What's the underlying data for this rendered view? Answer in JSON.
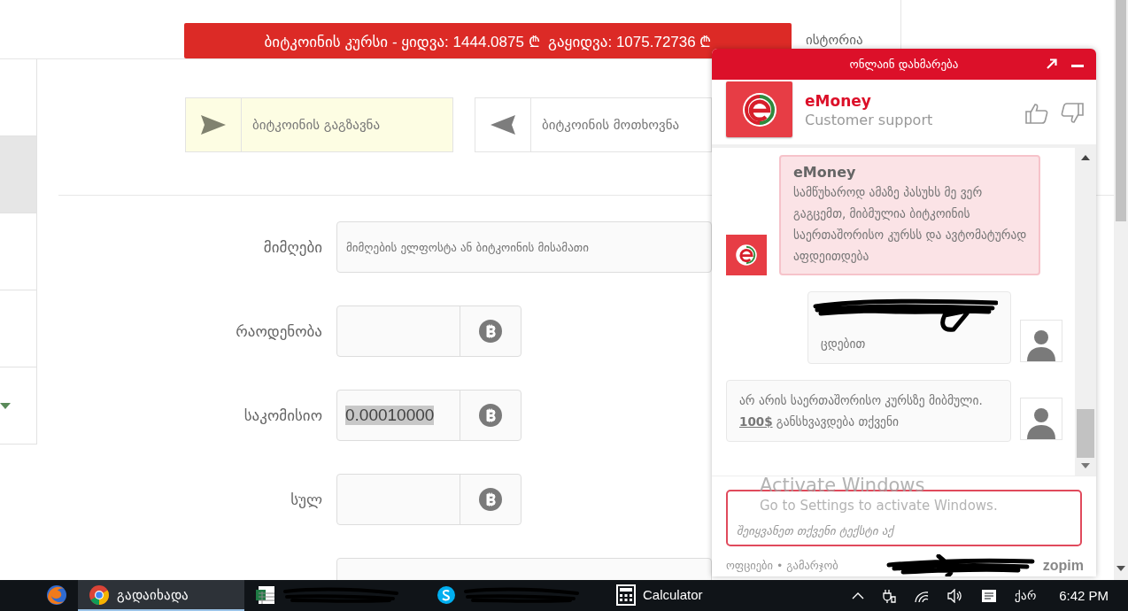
{
  "rate_banner": {
    "text": "ბიტკოინის კურსი - ყიდვა: 1444.0875 ₾  გაყიდვა: 1075.72736 ₾"
  },
  "history_link": "ისტორია",
  "sidebar_rows": [
    {
      "selected": false,
      "kind": "plain"
    },
    {
      "selected": true,
      "kind": "plain"
    },
    {
      "selected": false,
      "kind": "plain"
    },
    {
      "selected": false,
      "kind": "plain"
    },
    {
      "selected": false,
      "kind": "dropdown"
    }
  ],
  "action_buttons": [
    {
      "kind": "send",
      "label": "ბიტკოინის გაგზავნა",
      "selected": true
    },
    {
      "kind": "request",
      "label": "ბიტკოინის მოთხოვნა",
      "selected": false
    }
  ],
  "form": {
    "fields": [
      {
        "kind": "text",
        "label": "მიმღები",
        "placeholder": "მიმღების ელფოსტა ან ბიტკოინის მისამათი"
      },
      {
        "kind": "btc",
        "label": "რაოდენობა"
      },
      {
        "kind": "btc",
        "label": "საკომისიო",
        "value": "0.00010000",
        "value_selected": true
      },
      {
        "kind": "btc",
        "label": "სულ"
      },
      {
        "kind": "text"
      }
    ]
  },
  "chat": {
    "title": "ონლაინ დახმარება",
    "agent": {
      "name": "eMoney",
      "role": "Customer support"
    },
    "messages": [
      {
        "kind": "agent",
        "name": "eMoney",
        "text": "სამწუხაროდ ამაზე პასუხს მე ვერ გაგცემთ, მიბმულია ბიტკოინის საერთაშორისო კურსს და ავტომატურად აფდეითდება"
      },
      {
        "kind": "visitor",
        "redacted": true,
        "text": "ცდებით"
      },
      {
        "kind": "visitor",
        "redacted": false,
        "text": "არ არის საერთაშორისო კურსზე მიბმული. **100$** განსხვავდება თქვენი"
      }
    ],
    "input": {
      "placeholder": "შეიყვანეთ თქვენი ტექსტი აქ"
    },
    "footer": {
      "options": "ოფციები • გამარჯობ",
      "brand": "zopim"
    }
  },
  "activation_notice": {
    "title": "Activate Windows",
    "subtitle": "Go to Settings to activate Windows."
  },
  "taskbar": {
    "apps": [
      {
        "kind": "firefox",
        "selected": false
      },
      {
        "kind": "chrome",
        "label": "გადაიხადა",
        "selected": true
      },
      {
        "kind": "spreadsheet",
        "redacted": true,
        "selected": false
      },
      {
        "kind": "skype",
        "redacted": true,
        "selected": false
      },
      {
        "kind": "calculator",
        "label": "Calculator",
        "selected": false
      }
    ],
    "language": "ქარ",
    "time": "6:42 PM"
  }
}
